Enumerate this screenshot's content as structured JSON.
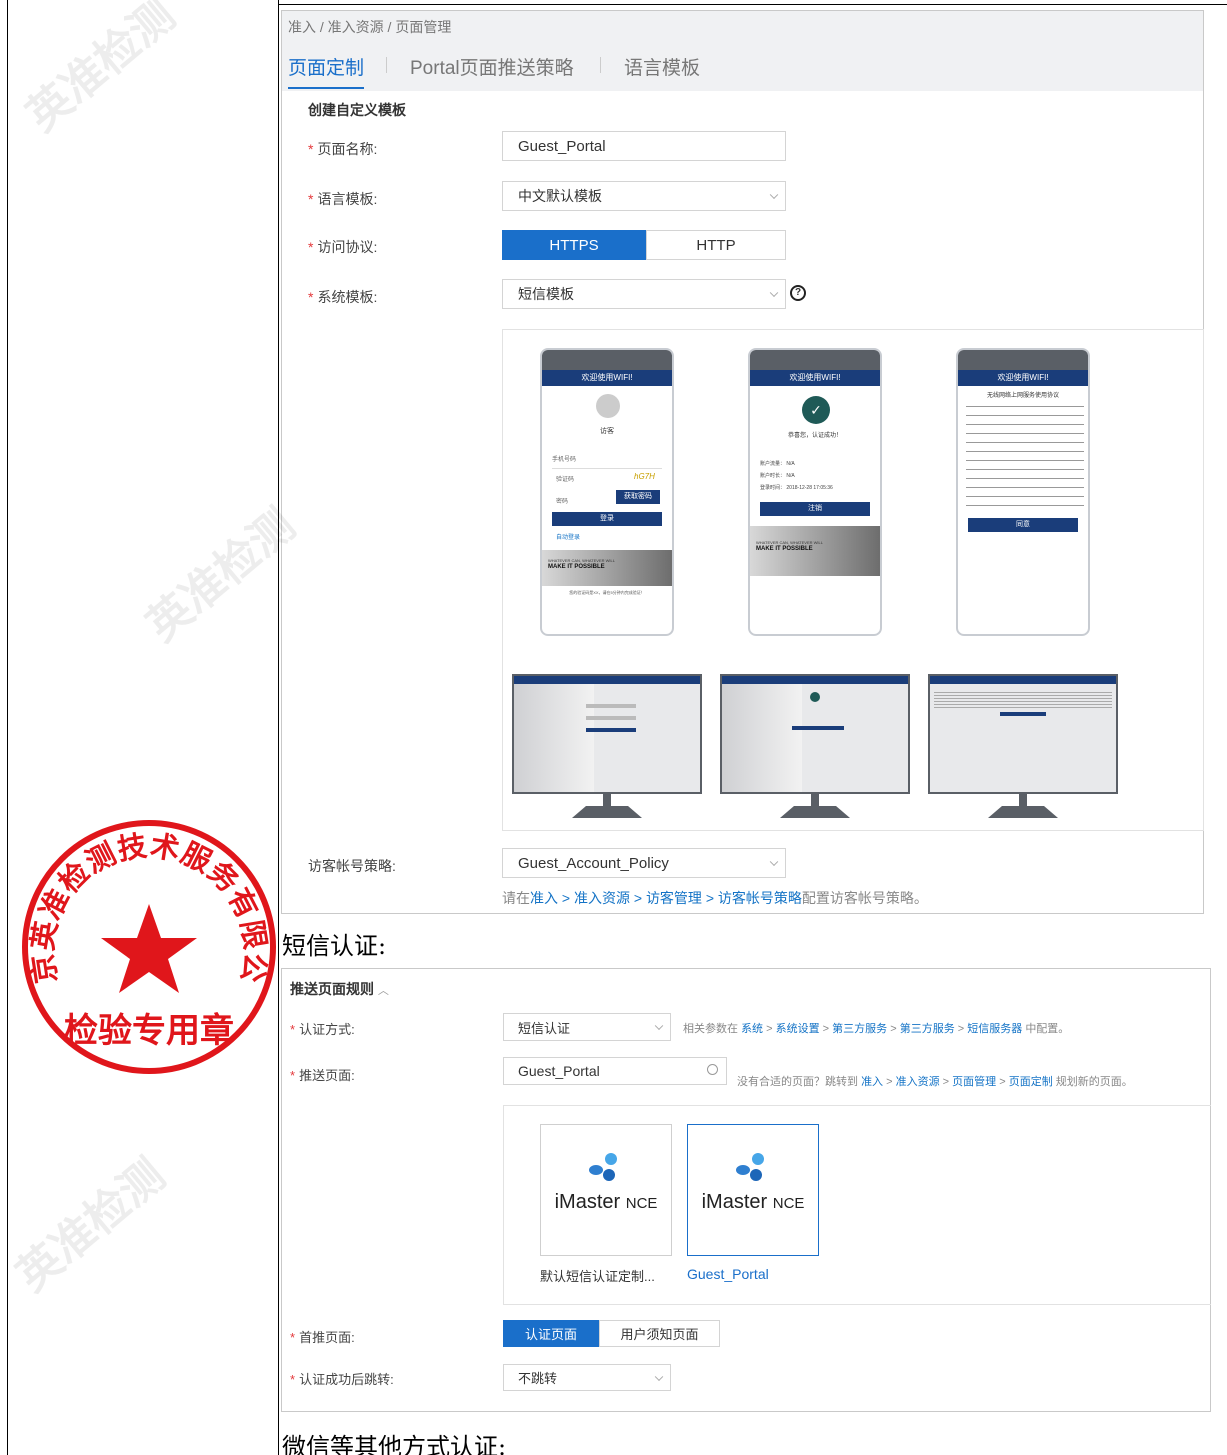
{
  "breadcrumb": "准入 / 准入资源 / 页面管理",
  "tabs": [
    {
      "label": "页面定制",
      "active": true
    },
    {
      "label": "Portal页面推送策略",
      "active": false
    },
    {
      "label": "语言模板",
      "active": false
    }
  ],
  "form1": {
    "section_title": "创建自定义模板",
    "page_name_label": "页面名称:",
    "page_name_value": "Guest_Portal",
    "lang_label": "语言模板:",
    "lang_value": "中文默认模板",
    "protocol_label": "访问协议:",
    "protocol_https": "HTTPS",
    "protocol_http": "HTTP",
    "sys_tpl_label": "系统模板:",
    "sys_tpl_value": "短信模板",
    "help_icon": "?",
    "guest_policy_label": "访客帐号策略:",
    "guest_policy_value": "Guest_Account_Policy",
    "hint_prefix": "请在",
    "hint_links": [
      "准入",
      "准入资源",
      "访客管理",
      "访客帐号策略"
    ],
    "hint_suffix": "配置访客帐号策略。",
    "sep": " > "
  },
  "previews": {
    "phone1": {
      "title": "欢迎使用WIFI!",
      "user": "访客",
      "phone_field": "手机号码",
      "code_field": "验证码",
      "captcha": "hG7H",
      "code_btn": "获取密码",
      "pwd_field": "密码",
      "login_btn": "登录",
      "remember": "自动登录",
      "banner_small": "WHATEVER CAN, WHATEVER WILL",
      "banner": "MAKE IT POSSIBLE",
      "footer": "您的验证码是XX，请在5分钟内完成验证！"
    },
    "phone2": {
      "title": "欢迎使用WIFI!",
      "success": "恭喜您，认证成功！",
      "rows": [
        [
          "账户流量：",
          "N/A"
        ],
        [
          "账户时长：",
          "N/A"
        ],
        [
          "登录时间：",
          "2018-12-28 17:05:36"
        ]
      ],
      "logout_btn": "注销",
      "banner_small": "WHATEVER CAN, WHATEVER WILL",
      "banner": "MAKE IT POSSIBLE"
    },
    "phone3": {
      "title": "欢迎使用WIFI!",
      "agreement_title": "无线网络上网服务使用协议",
      "agree_btn": "同意"
    }
  },
  "sms_heading": "短信认证:",
  "form2": {
    "section_title": "推送页面规则",
    "auth_label": "认证方式:",
    "auth_value": "短信认证",
    "auth_hint_prefix": "相关参数在",
    "auth_hint_links": [
      "系统",
      "系统设置",
      "第三方服务",
      "第三方服务",
      "短信服务器"
    ],
    "auth_hint_suffix": "中配置。",
    "push_label": "推送页面:",
    "push_value": "Guest_Portal",
    "push_hint_prefix": "没有合适的页面？跳转到",
    "push_hint_links": [
      "准入",
      "准入资源",
      "页面管理",
      "页面定制"
    ],
    "push_hint_suffix": "规划新的页面。",
    "cards": [
      {
        "brand": "iMaster",
        "brand_suffix": "NCE",
        "caption": "默认短信认证定制..."
      },
      {
        "brand": "iMaster",
        "brand_suffix": "NCE",
        "caption": "Guest_Portal"
      }
    ],
    "first_page_label": "首推页面:",
    "first_page_active": "认证页面",
    "first_page_other": "用户须知页面",
    "redirect_label": "认证成功后跳转:",
    "redirect_value": "不跳转"
  },
  "wechat_heading": "微信等其他方式认证:",
  "stamp": {
    "text": "北京英准检测技术服务有限公司",
    "bottom": "检验专用章"
  },
  "watermark": "英准检测",
  "colors": {
    "primary": "#1a6fca",
    "stamp": "#e0161b",
    "navy": "#1a3d7a"
  }
}
